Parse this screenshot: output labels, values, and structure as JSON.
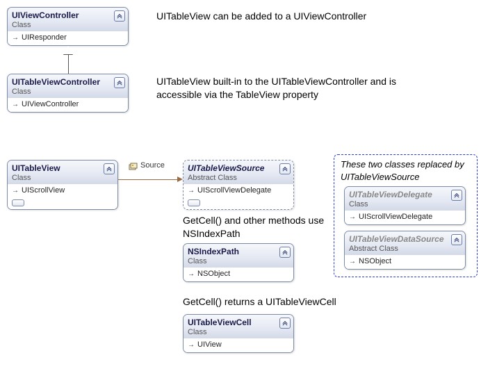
{
  "boxes": {
    "uivc": {
      "name": "UIViewController",
      "stereo": "Class",
      "inherits": "UIResponder"
    },
    "uitvc": {
      "name": "UITableViewController",
      "stereo": "Class",
      "inherits": "UIViewController"
    },
    "uitv": {
      "name": "UITableView",
      "stereo": "Class",
      "inherits": "UIScrollView"
    },
    "src": {
      "name": "UITableViewSource",
      "stereo": "Abstract Class",
      "inherits": "UIScrollViewDelegate"
    },
    "nsip": {
      "name": "NSIndexPath",
      "stereo": "Class",
      "inherits": "NSObject"
    },
    "cell": {
      "name": "UITableViewCell",
      "stereo": "Class",
      "inherits": "UIView"
    },
    "del": {
      "name": "UITableViewDelegate",
      "stereo": "Class",
      "inherits": "UIScrollViewDelegate"
    },
    "ds": {
      "name": "UITableViewDataSource",
      "stereo": "Abstract Class",
      "inherits": "NSObject"
    }
  },
  "assoc_label": "Source",
  "annotations": {
    "a1": "UITableView can be added to a  UIViewController",
    "a2": "UITableView built-in to the UITableViewController and is accessible via the TableView property",
    "a3": "GetCell() and other methods use NSIndexPath",
    "a4": "GetCell() returns a UITableViewCell",
    "note": "These two classes replaced by UITableViewSource"
  }
}
